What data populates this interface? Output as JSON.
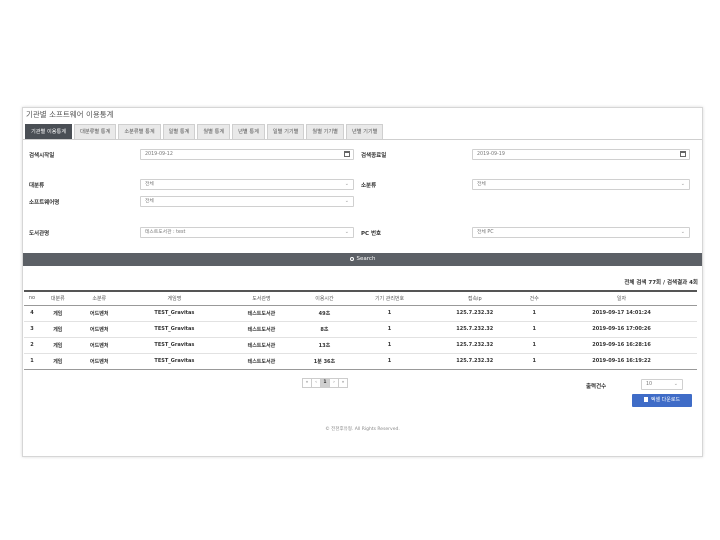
{
  "page": {
    "title": "기관별 소프트웨어 이용통계"
  },
  "tabs": [
    {
      "label": "기관별 이용통계",
      "active": true
    },
    {
      "label": "대분류별 통계"
    },
    {
      "label": "소분류별 통계"
    },
    {
      "label": "일별 통계"
    },
    {
      "label": "월별 통계"
    },
    {
      "label": "년별 통계"
    },
    {
      "label": "일별 기기별"
    },
    {
      "label": "월별 기기별"
    },
    {
      "label": "년별 기기별"
    }
  ],
  "form": {
    "start_label": "검색시작일",
    "start_value": "2019-09-12",
    "end_label": "검색종료일",
    "end_value": "2019-09-19",
    "major_label": "대분류",
    "major_value": "전체",
    "minor_label": "소분류",
    "minor_value": "전체",
    "software_label": "소프트웨어명",
    "software_value": "전체",
    "library_label": "도서관명",
    "library_value": "테스트도서관 : test",
    "pc_label": "PC 번호",
    "pc_value": "전체 PC"
  },
  "search_label": "Search",
  "summary": "전체 검색 77회 / 검색결과 4회",
  "table": {
    "headers": [
      "no",
      "대분류",
      "소분류",
      "게임명",
      "도서관명",
      "이용시간",
      "기기 관리번호",
      "접속ip",
      "건수",
      "일자"
    ],
    "rows": [
      [
        "4",
        "게임",
        "어드벤처",
        "TEST_Gravitas",
        "테스트도서관",
        "49초",
        "1",
        "125.7.232.32",
        "1",
        "2019-09-17 14:01:24"
      ],
      [
        "3",
        "게임",
        "어드벤처",
        "TEST_Gravitas",
        "테스트도서관",
        "8초",
        "1",
        "125.7.232.32",
        "1",
        "2019-09-16 17:00:26"
      ],
      [
        "2",
        "게임",
        "어드벤처",
        "TEST_Gravitas",
        "테스트도서관",
        "13초",
        "1",
        "125.7.232.32",
        "1",
        "2019-09-16 16:28:16"
      ],
      [
        "1",
        "게임",
        "어드벤처",
        "TEST_Gravitas",
        "테스트도서관",
        "1분 36초",
        "1",
        "125.7.232.32",
        "1",
        "2019-09-16 16:19:22"
      ]
    ]
  },
  "pagination": {
    "first": "«",
    "prev": "‹",
    "current": "1",
    "next": "›",
    "last": "»"
  },
  "rows_per_page": {
    "label": "출력건수",
    "value": "10"
  },
  "excel_label": "엑셀 다운로드",
  "footer": "© 전천후유형. All Rights Reserved.",
  "colors": {
    "tab_active": "#4a4f55",
    "search_button": "#5c6066",
    "excel_button": "#3f6cc7"
  },
  "icons": {
    "calendar": "calendar-icon",
    "search": "search-icon",
    "excel": "file-icon"
  }
}
